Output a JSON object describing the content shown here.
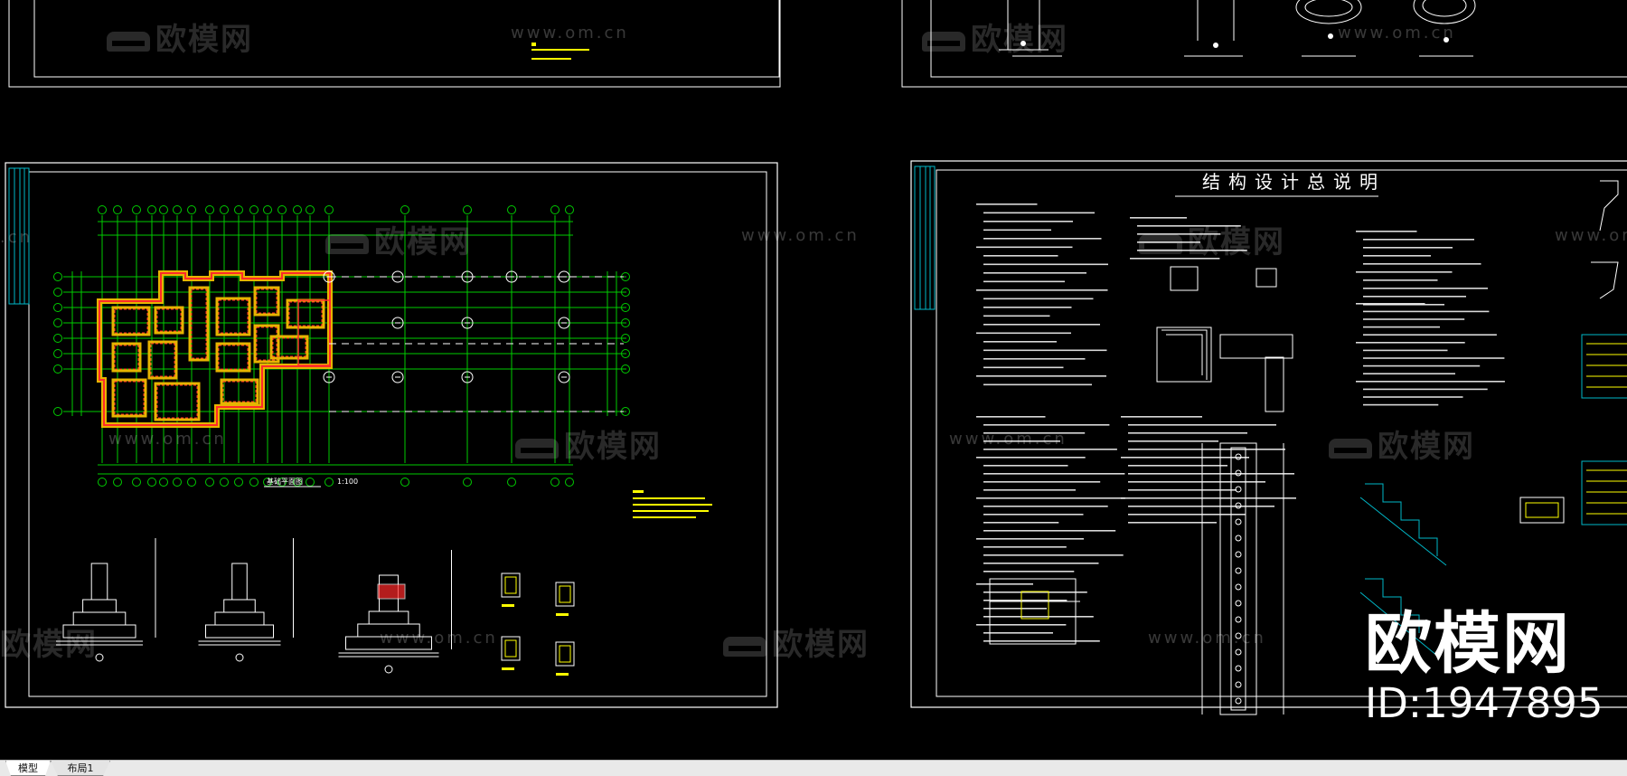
{
  "drawing": {
    "sheet_left": {
      "plan_title": "基础平面图",
      "plan_scale": "1:100"
    },
    "sheet_right": {
      "title": "结构设计总说明"
    }
  },
  "watermark": {
    "brand_cn": "欧模网",
    "url": "www.om.cn",
    "url_short": ".cn"
  },
  "branding": {
    "logo": "欧模网",
    "id": "ID:1947895"
  },
  "tabs": [
    {
      "label": "模型"
    },
    {
      "label": "布局1"
    }
  ],
  "colors": {
    "background": "#000000",
    "frame": "#ffffff",
    "axis_grid": "#00cc00",
    "wall_red": "#ff2a2a",
    "wall_yellow": "#e6b400",
    "note_yellow": "#ffff00",
    "cyan": "#00b7c7"
  }
}
